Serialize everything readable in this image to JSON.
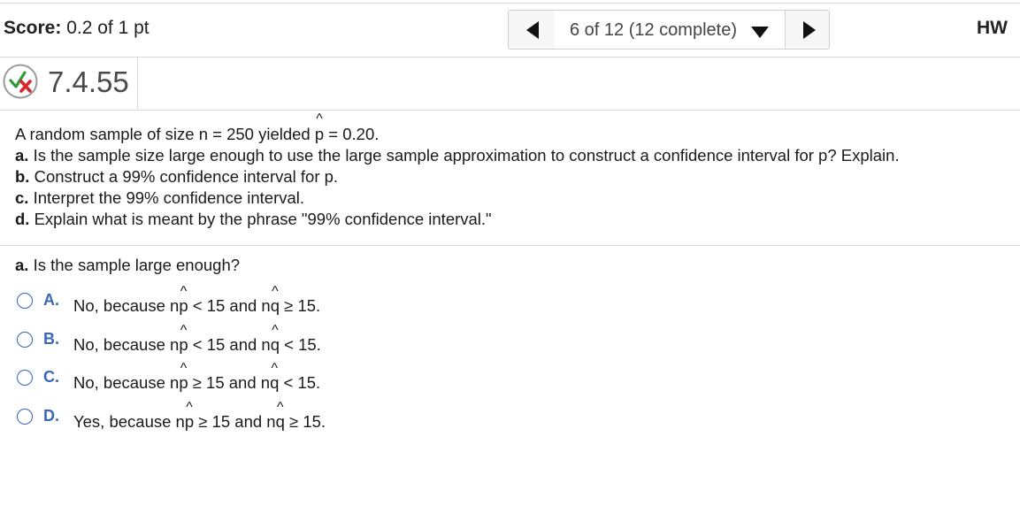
{
  "header": {
    "score_label": "Score:",
    "score_value": "0.2 of 1 pt",
    "nav_label": "6 of 12 (12 complete)",
    "hw_label": "HW"
  },
  "question": {
    "number": "7.4.55",
    "status": "partially-correct"
  },
  "problem": {
    "line1_prefix": "A random sample of size n = 250 yielded ",
    "line1_var": "p",
    "line1_suffix": " = 0.20.",
    "parts": [
      {
        "label": "a.",
        "text": " Is the sample size large enough to use the large sample approximation to construct a confidence interval for p? Explain."
      },
      {
        "label": "b.",
        "text": " Construct a 99% confidence interval for p."
      },
      {
        "label": "c.",
        "text": " Interpret the 99% confidence interval."
      },
      {
        "label": "d.",
        "text": " Explain what is meant by the phrase \"99% confidence interval.\""
      }
    ]
  },
  "part_a": {
    "label": "a.",
    "prompt": " Is the sample large enough?",
    "options": [
      {
        "letter": "A.",
        "t1": "No, because n",
        "v1": "p",
        "t2": " < 15 and n",
        "v2": "q",
        "t3": " ≥ 15."
      },
      {
        "letter": "B.",
        "t1": "No, because n",
        "v1": "p",
        "t2": " < 15 and n",
        "v2": "q",
        "t3": " < 15."
      },
      {
        "letter": "C.",
        "t1": "No, because n",
        "v1": "p",
        "t2": " ≥ 15 and n",
        "v2": "q",
        "t3": " < 15."
      },
      {
        "letter": "D.",
        "t1": "Yes, because n",
        "v1": "p",
        "t2": " ≥ 15 and n",
        "v2": "q",
        "t3": " ≥ 15."
      }
    ]
  },
  "colors": {
    "accent": "#3a67b6",
    "correct_check": "#2e9b3a",
    "incorrect_x": "#d9262b"
  }
}
